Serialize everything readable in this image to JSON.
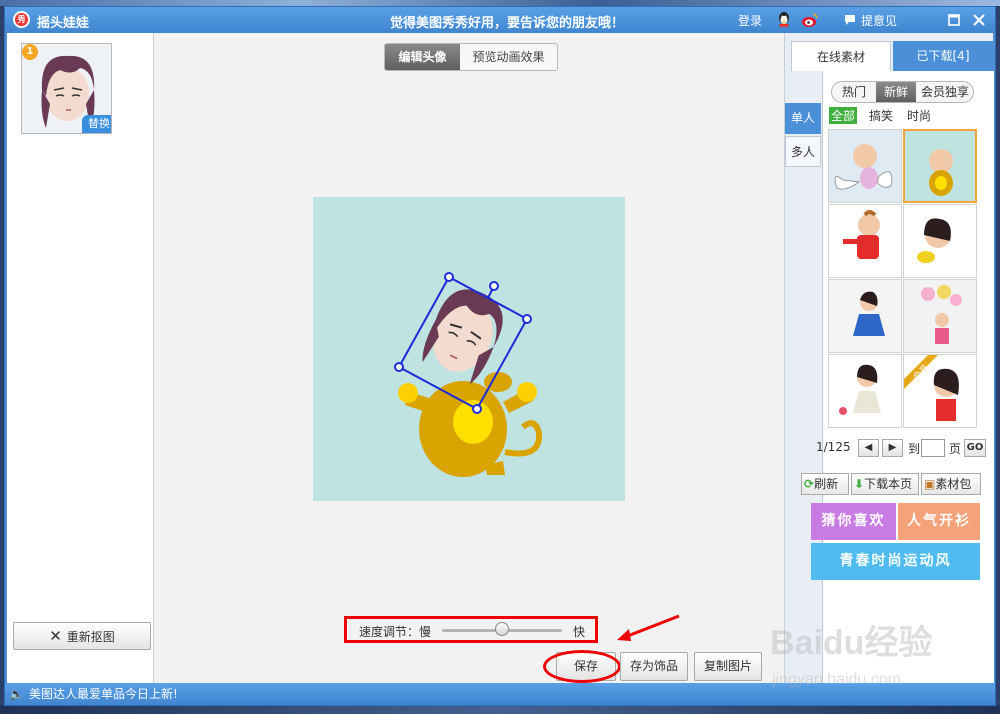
{
  "window": {
    "title": "摇头娃娃",
    "slogan": "觉得美图秀秀好用，要告诉您的朋友哦！",
    "login_label": "登录",
    "feedback_label": "提意见",
    "status_text": "美图达人最爱单品今日上新!"
  },
  "left_panel": {
    "thumbnail_index": "1",
    "replace_label": "替换",
    "recut_label": "重新抠图"
  },
  "center": {
    "tabs": [
      {
        "label": "编辑头像",
        "active": true
      },
      {
        "label": "预览动画效果",
        "active": false
      }
    ],
    "speed_label": "速度调节：慢",
    "speed_fast_label": "快",
    "speed_value": 0.5,
    "buttons": {
      "save": "保存",
      "save_as_accessory": "存为饰品",
      "copy_image": "复制图片"
    }
  },
  "right_panel": {
    "tabs": [
      {
        "label": "在线素材",
        "active": true
      },
      {
        "label": "已下载[4]",
        "active": false
      }
    ],
    "side_tabs": [
      {
        "label": "单人",
        "active": true
      },
      {
        "label": "多人",
        "active": false
      }
    ],
    "segments": [
      {
        "label": "热门",
        "active": false
      },
      {
        "label": "新鲜",
        "active": true
      },
      {
        "label": "会员独享",
        "active": false
      }
    ],
    "filters": [
      {
        "label": "全部",
        "active": true
      },
      {
        "label": "搞笑",
        "active": false
      },
      {
        "label": "时尚",
        "active": false
      }
    ],
    "grid_items": [
      {
        "name": "angel-baby",
        "selected": false
      },
      {
        "name": "monkey-baby",
        "selected": true
      },
      {
        "name": "red-suit-baby",
        "selected": false
      },
      {
        "name": "bear-girl",
        "selected": false
      },
      {
        "name": "blue-dress-girl",
        "selected": false
      },
      {
        "name": "balloon-girl",
        "selected": false
      },
      {
        "name": "garden-girl",
        "selected": false
      },
      {
        "name": "vip-girl",
        "selected": false,
        "badge": "会员"
      }
    ],
    "pager": {
      "page_text": "1/125",
      "goto_label": "到",
      "page_unit": "页",
      "go_label": "GO"
    },
    "actions": {
      "refresh": "刷新",
      "download_page": "下载本页",
      "material_pack": "素材包"
    },
    "promos": [
      {
        "label": "猜你喜欢",
        "color": "#c77be3"
      },
      {
        "label": "人气开衫",
        "color": "#f5a27a"
      },
      {
        "label": "青春时尚运动风",
        "color": "#4fbbf0"
      }
    ]
  },
  "watermark": {
    "text_main": "Baidu经验",
    "text_url": "jingyan.baidu.com"
  },
  "colors": {
    "titlebar": "#4a8fd8",
    "canvas_bg": "#bfe3e1",
    "highlight": "#e00000",
    "monkey": "#d9a400"
  }
}
